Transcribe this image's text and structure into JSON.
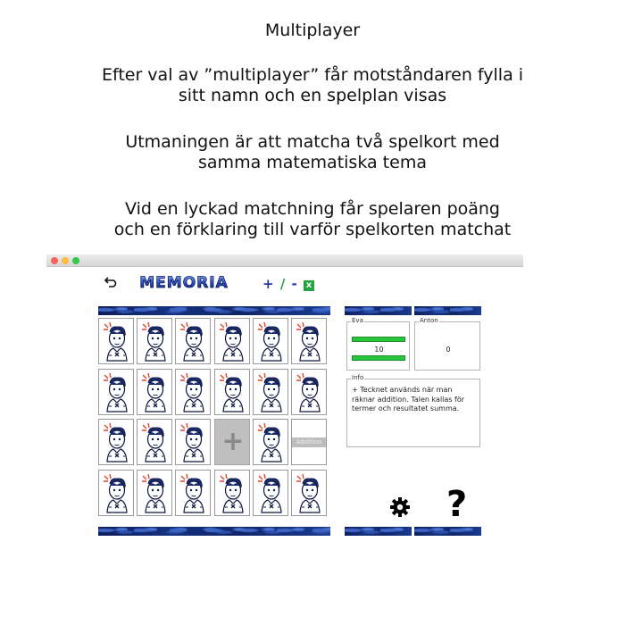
{
  "caption": {
    "title": "Multiplayer",
    "para1_line1": "Efter val av ”multiplayer” får motståndaren fylla i",
    "para1_line2": "sitt namn och en spelplan visas",
    "para2_line1": "Utmaningen är att matcha två spelkort med",
    "para2_line2": "samma matematiska tema",
    "para3_line1": "Vid en lyckad matchning får spelaren poäng",
    "para3_line2": "och en förklaring till varför spelkorten matchat"
  },
  "app": {
    "logo_text": "MEMORIA",
    "ops": {
      "plus": "+",
      "slash": "/",
      "minus": "-",
      "times": "x"
    },
    "board": {
      "rows": 4,
      "cols": 6,
      "revealed": [
        {
          "row": 2,
          "col": 3,
          "type": "symbol",
          "content": "+"
        },
        {
          "row": 2,
          "col": 5,
          "type": "text",
          "content": "Addition"
        }
      ]
    },
    "player1": {
      "name": "Eva",
      "score": "10"
    },
    "player2": {
      "name": "Anton",
      "score": "0"
    },
    "info": {
      "label": "Info",
      "text": "+ Tecknet används när man\nräknar addition. Talen kallas för\ntermer och resultatet summa."
    },
    "help_symbol": "?",
    "colors": {
      "accent_blue": "#2536a8",
      "score_green": "#27c53a",
      "bar_blue": "#16317f"
    }
  }
}
